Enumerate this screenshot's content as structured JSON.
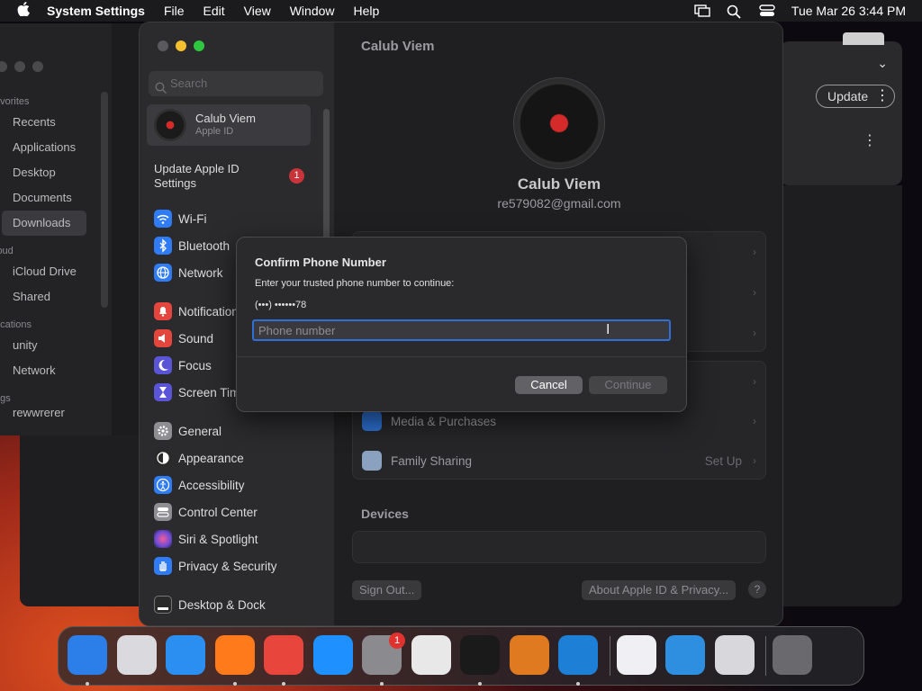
{
  "menubar": {
    "app_name": "System Settings",
    "menus": [
      "File",
      "Edit",
      "View",
      "Window",
      "Help"
    ],
    "clock": "Tue Mar 26  3:44 PM"
  },
  "finder": {
    "sections": [
      {
        "title": "avorites",
        "items": [
          "Recents",
          "Applications",
          "Desktop",
          "Documents",
          "Downloads"
        ]
      },
      {
        "title": "loud",
        "items": [
          "iCloud Drive",
          "Shared"
        ]
      },
      {
        "title": "ocations",
        "items": [
          "unity",
          "Network"
        ]
      },
      {
        "title": "ags",
        "items": [
          "rewwrerer"
        ]
      }
    ],
    "selected": "Downloads"
  },
  "bg_window": {
    "update_label": "Update"
  },
  "settings": {
    "search_placeholder": "Search",
    "account": {
      "name": "Calub Viem",
      "sub": "Apple ID"
    },
    "update_notice": "Update Apple ID Settings",
    "update_badge": "1",
    "items": [
      {
        "label": "Wi-Fi",
        "icon": "wifi-icon",
        "color": "#2f7cf6"
      },
      {
        "label": "Bluetooth",
        "icon": "bluetooth-icon",
        "color": "#2f7cf6"
      },
      {
        "label": "Network",
        "icon": "globe-icon",
        "color": "#2f7cf6"
      },
      {
        "label": "Notifications",
        "icon": "bell-icon",
        "color": "#e4453c"
      },
      {
        "label": "Sound",
        "icon": "speaker-icon",
        "color": "#e4453c"
      },
      {
        "label": "Focus",
        "icon": "moon-icon",
        "color": "#5a55d6"
      },
      {
        "label": "Screen Time",
        "icon": "hourglass-icon",
        "color": "#5a55d6"
      },
      {
        "label": "General",
        "icon": "gear-icon",
        "color": "#8e8e93"
      },
      {
        "label": "Appearance",
        "icon": "appearance-icon",
        "color": "#2a2a2a"
      },
      {
        "label": "Accessibility",
        "icon": "accessibility-icon",
        "color": "#2f7cf6"
      },
      {
        "label": "Control Center",
        "icon": "control-center-icon",
        "color": "#8e8e93"
      },
      {
        "label": "Siri & Spotlight",
        "icon": "siri-icon",
        "color": "#b44fd6"
      },
      {
        "label": "Privacy & Security",
        "icon": "hand-icon",
        "color": "#2f7cf6"
      },
      {
        "label": "Desktop & Dock",
        "icon": "dock-icon",
        "color": "#2a2a2a"
      }
    ],
    "window_title": "Calub Viem",
    "profile_name": "Calub Viem",
    "profile_email": "re579082@gmail.com",
    "rows": [
      {
        "label": "Media & Purchases",
        "right": ""
      },
      {
        "label": "Family Sharing",
        "right": "Set Up"
      }
    ],
    "devices_heading": "Devices",
    "sign_out": "Sign Out...",
    "about": "About Apple ID & Privacy...",
    "help": "?"
  },
  "dialog": {
    "title": "Confirm Phone Number",
    "message": "Enter your trusted phone number to continue:",
    "masked_phone": "(•••) ••••••78",
    "input_value": "",
    "input_placeholder": "Phone number",
    "cancel": "Cancel",
    "continue": "Continue"
  },
  "dock": {
    "items": [
      {
        "name": "finder-icon",
        "color": "#2c7ee8",
        "running": true
      },
      {
        "name": "launchpad-icon",
        "color": "#d9d9de",
        "running": false
      },
      {
        "name": "safari-icon",
        "color": "#2a8ff0",
        "running": false
      },
      {
        "name": "firefox-icon",
        "color": "#ff7a1a",
        "running": true
      },
      {
        "name": "chrome-icon",
        "color": "#e8453c",
        "running": true
      },
      {
        "name": "app-store-icon",
        "color": "#1e90ff",
        "running": false
      },
      {
        "name": "system-settings-icon",
        "color": "#8a8a8f",
        "running": true,
        "badge": "1"
      },
      {
        "name": "textedit-icon",
        "color": "#e8e8e8",
        "running": false
      },
      {
        "name": "terminal-icon",
        "color": "#1a1a1a",
        "running": true
      },
      {
        "name": "garageband-icon",
        "color": "#e07a20",
        "running": false
      },
      {
        "name": "vscode-icon",
        "color": "#1e7fd6",
        "running": true
      },
      {
        "name": "visual-studio-icon",
        "color": "#f0f0f4",
        "running": false
      },
      {
        "name": "weather-icon",
        "color": "#2e8fe0",
        "running": false
      },
      {
        "name": "downloads-stack-icon",
        "color": "#d8d8dc",
        "running": false
      },
      {
        "name": "trash-icon",
        "color": "#6a6a6e",
        "running": false
      }
    ]
  }
}
